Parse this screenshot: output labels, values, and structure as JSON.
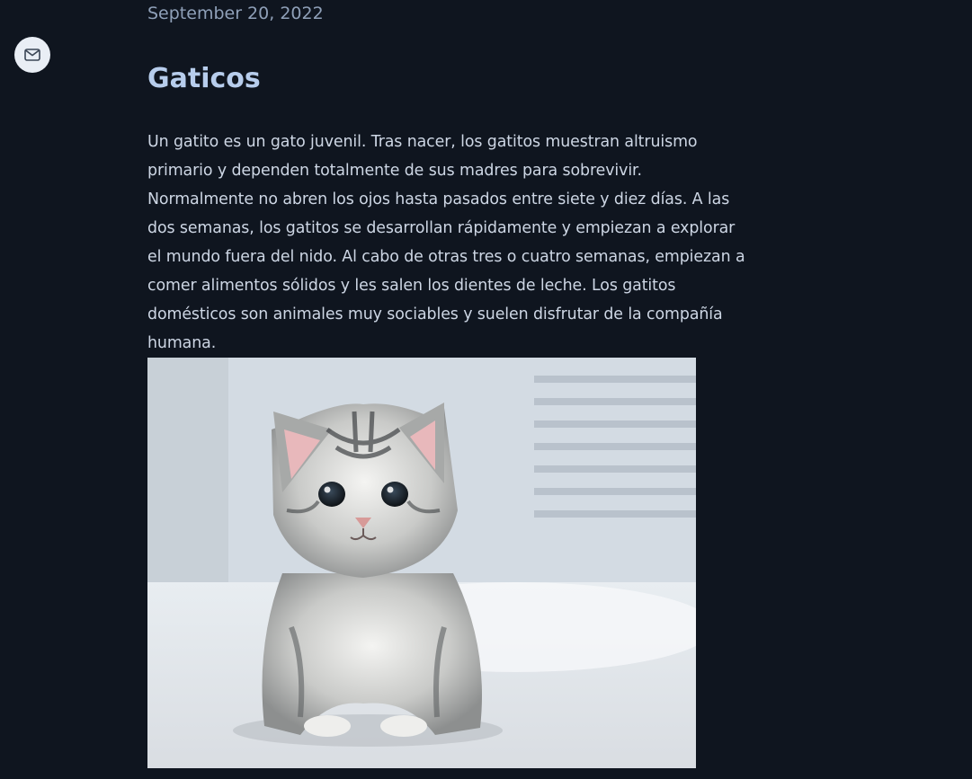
{
  "sidebar": {
    "mail_icon": "mail-icon"
  },
  "post": {
    "date": "September 20, 2022",
    "title": "Gaticos",
    "body": "Un gatito es un gato juvenil. Tras nacer, los gatitos muestran altruismo primario y dependen totalmente de sus madres para sobrevivir. Normalmente no abren los ojos hasta pasados entre siete y diez días. A las dos semanas, los gatitos se desarrollan rápidamente y empiezan a explorar el mundo fuera del nido. Al cabo de otras tres o cuatro semanas, empiezan a comer alimentos sólidos y les salen los dientes de leche. Los gatitos domésticos son animales muy sociables y suelen disfrutar de la compañía humana.",
    "image": {
      "subject": "tabby kitten photo"
    }
  },
  "colors": {
    "background": "#0f151f",
    "title": "#b7cdec",
    "date": "#8fa0b8",
    "text": "#cdd6e4",
    "mail_button_bg": "#e9eef5"
  }
}
